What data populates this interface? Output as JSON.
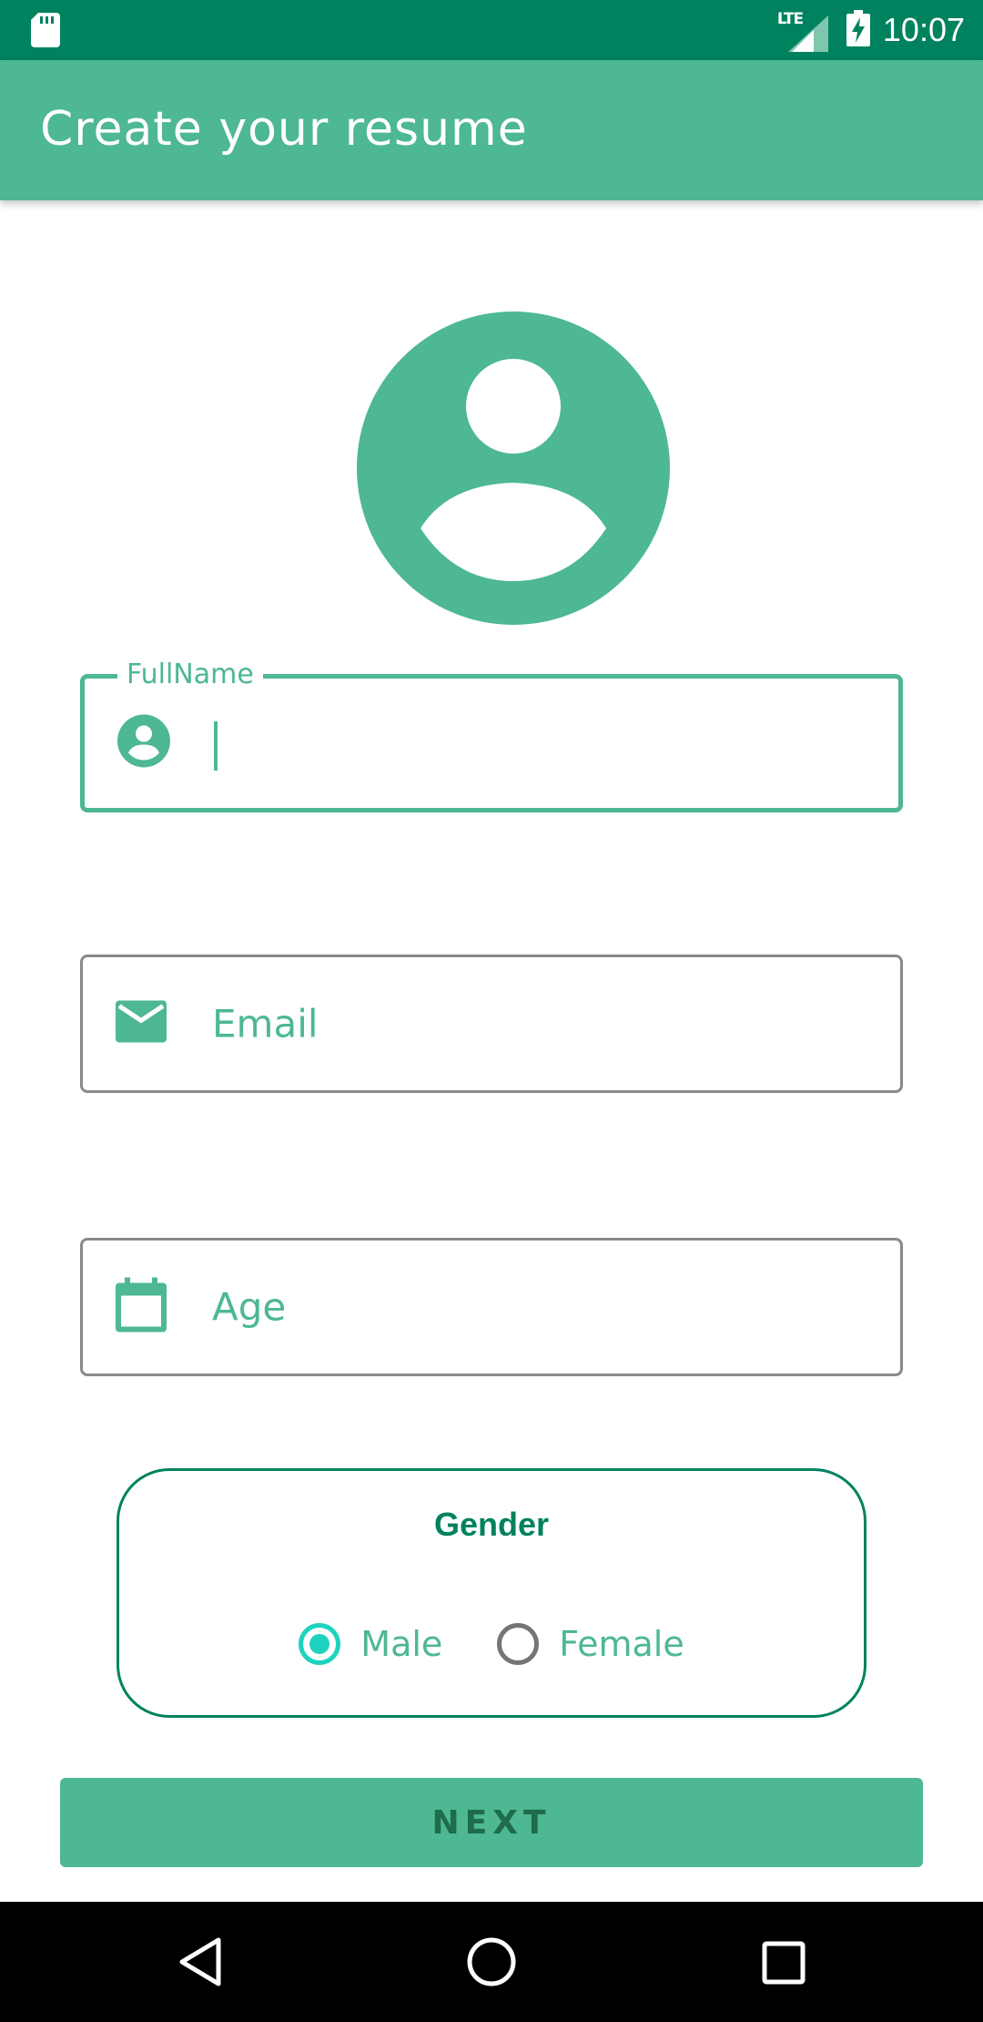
{
  "status_bar": {
    "time": "10:07",
    "network": "LTE",
    "icons": [
      "sd-card-icon",
      "signal-icon",
      "battery-charging-icon"
    ]
  },
  "app_bar": {
    "title": "Create your resume"
  },
  "avatar": {
    "icon": "account-circle-icon",
    "color": "#4DB891"
  },
  "form": {
    "full_name": {
      "label": "FullName",
      "value": "",
      "icon": "account-icon"
    },
    "email": {
      "placeholder": "Email",
      "icon": "email-icon"
    },
    "age": {
      "placeholder": "Age",
      "icon": "calendar-icon"
    }
  },
  "gender": {
    "title": "Gender",
    "options": [
      {
        "label": "Male",
        "checked": true
      },
      {
        "label": "Female",
        "checked": false
      }
    ]
  },
  "next_button": {
    "label": "NEXT"
  },
  "nav_bar": {
    "buttons": [
      "back-icon",
      "home-icon",
      "recents-icon"
    ]
  },
  "colors": {
    "primary": "#4DB891",
    "primary_dark": "#00825F",
    "radio_accent": "#1DD3C0"
  }
}
